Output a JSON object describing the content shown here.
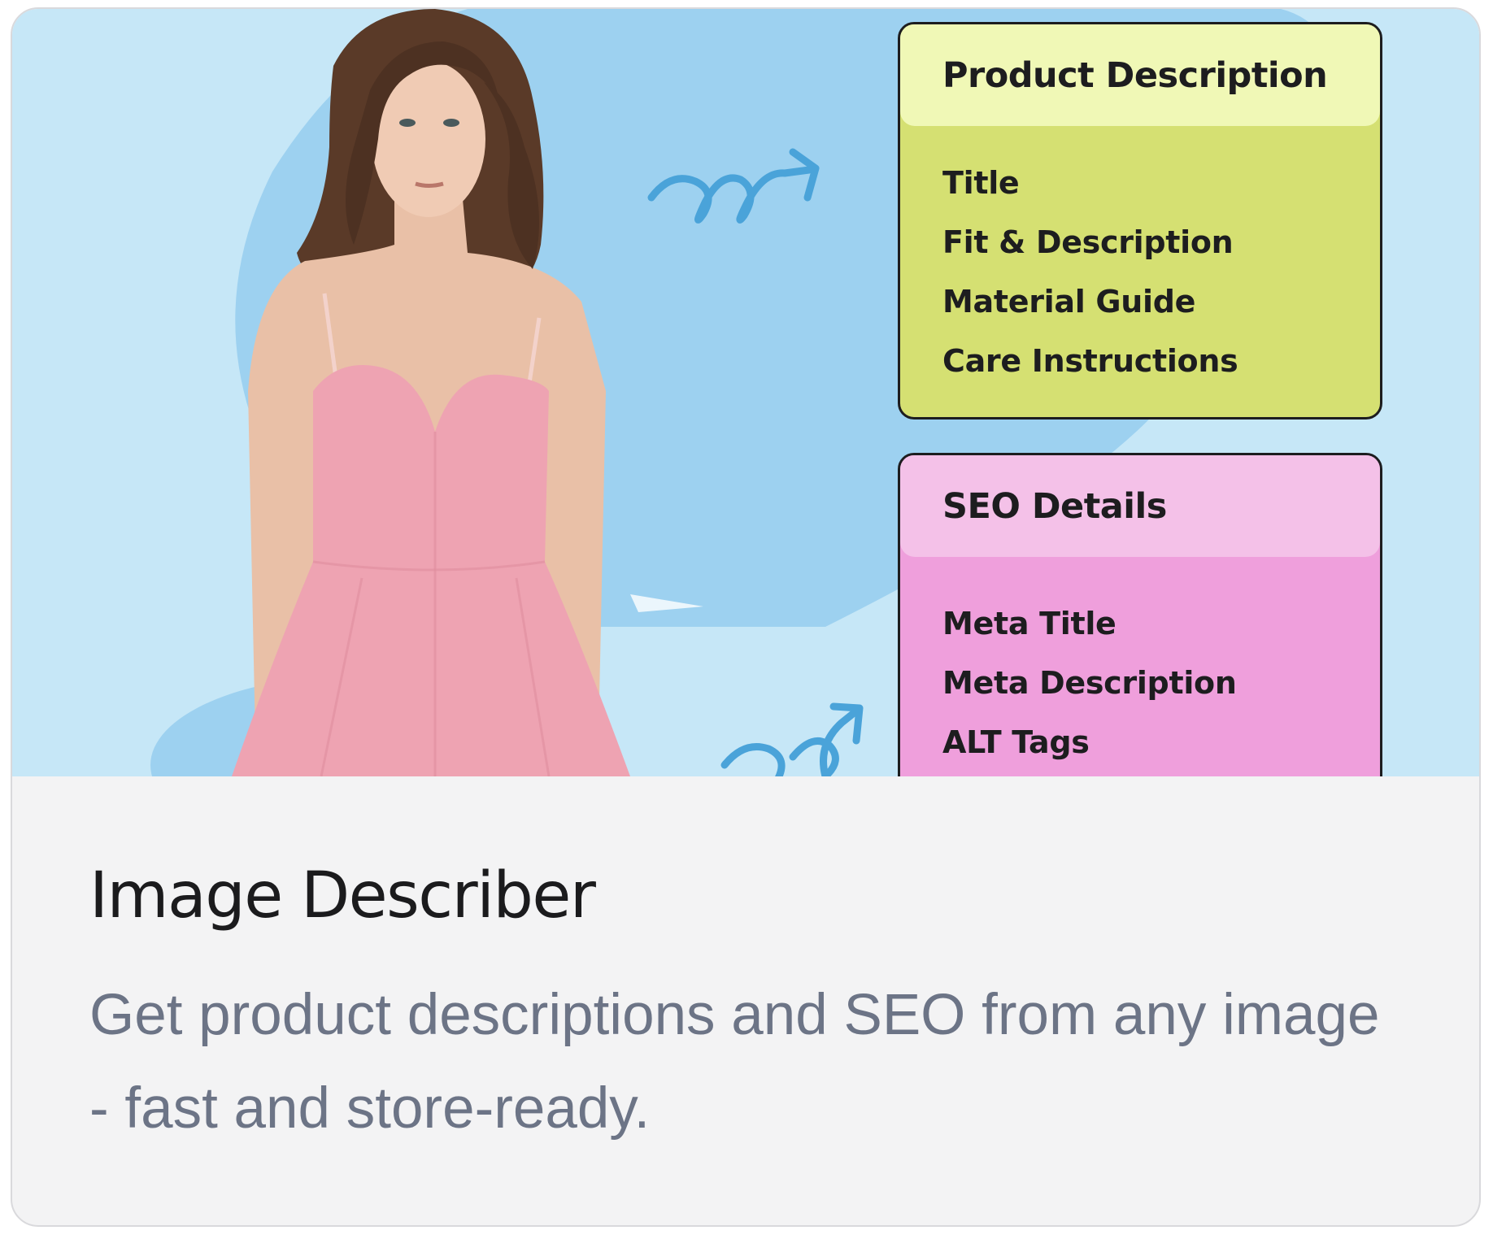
{
  "card": {
    "title": "Image Describer",
    "description": "Get product descriptions and SEO from any image - fast and store-ready."
  },
  "hero": {
    "product_panel": {
      "title": "Product Description",
      "items": [
        "Title",
        "Fit & Description",
        "Material Guide",
        "Care Instructions"
      ],
      "color": "#d5e072"
    },
    "seo_panel": {
      "title": "SEO Details",
      "items": [
        "Meta Title",
        "Meta Description",
        "ALT Tags"
      ],
      "color": "#ef9fdc"
    },
    "arrow_icon": "squiggle-arrow-icon",
    "model_image": "woman-in-pink-dress"
  }
}
